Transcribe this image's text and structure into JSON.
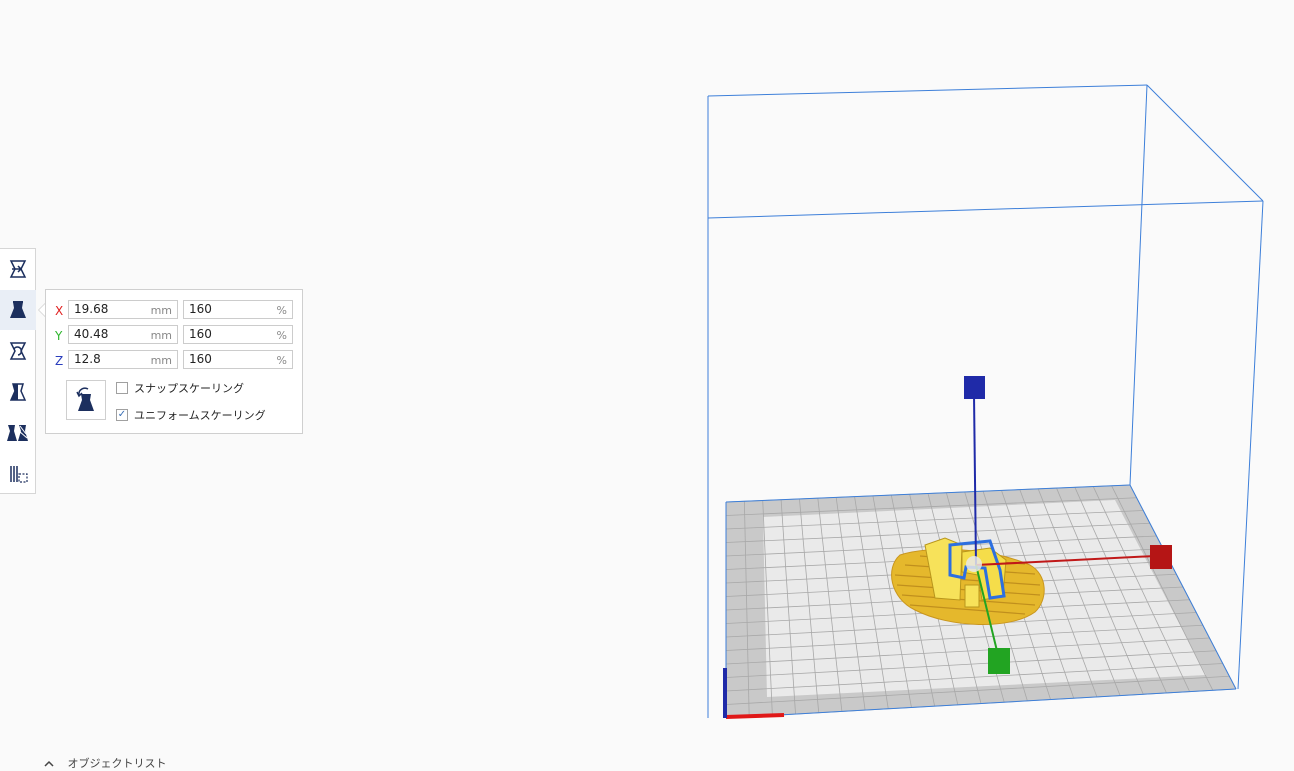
{
  "scale_panel": {
    "rows": [
      {
        "axis": "X",
        "color": "#e02020",
        "size": "19.68",
        "size_unit": "mm",
        "percent": "160",
        "percent_unit": "%"
      },
      {
        "axis": "Y",
        "color": "#2db52d",
        "size": "40.48",
        "size_unit": "mm",
        "percent": "160",
        "percent_unit": "%"
      },
      {
        "axis": "Z",
        "color": "#2a3dbd",
        "size": "12.8",
        "size_unit": "mm",
        "percent": "160",
        "percent_unit": "%"
      }
    ],
    "snap_scaling": {
      "label": "スナップスケーリング",
      "checked": false
    },
    "uniform_scaling": {
      "label": "ユニフォームスケーリング",
      "checked": true,
      "check_mark": "✓"
    },
    "reset_icon": "reset-scale-icon"
  },
  "toolbar": {
    "tools": [
      {
        "name": "move-tool",
        "icon": "move-icon",
        "active": false
      },
      {
        "name": "scale-tool",
        "icon": "scale-icon",
        "active": true
      },
      {
        "name": "rotate-tool",
        "icon": "rotate-icon",
        "active": false
      },
      {
        "name": "mirror-tool",
        "icon": "mirror-icon",
        "active": false
      },
      {
        "name": "per-model-settings-tool",
        "icon": "per-model-settings-icon",
        "active": false
      },
      {
        "name": "support-blocker-tool",
        "icon": "support-blocker-icon",
        "active": false
      }
    ]
  },
  "object_list": {
    "label": "オブジェクトリスト",
    "icon": "chevron-up-icon"
  },
  "scene": {
    "build_volume_color": "#3d7fd9",
    "plate_color": "#c8c8c8",
    "model_color": "#f2d43a",
    "selection_outline_color": "#2d6fe0",
    "handle_x_color": "#c01818",
    "handle_y_color": "#22a422",
    "handle_z_color": "#1f2aa8"
  }
}
